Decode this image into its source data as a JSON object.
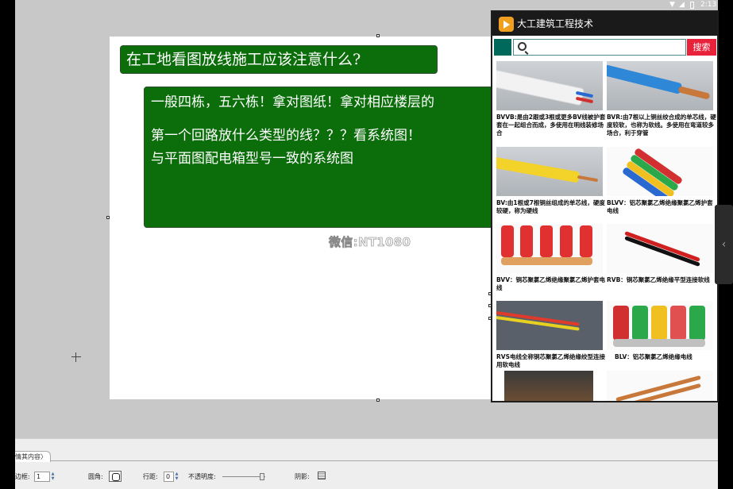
{
  "slide": {
    "title": "在工地看图放线施工应该注意什么?",
    "lines": [
      "一般四栋，五六栋！拿对图纸！拿对相应楼层的",
      "第一个回路放什么类型的线？？？看系统图！",
      "与平面图配电箱型号一致的系统图"
    ],
    "watermark": "微信:NT1080"
  },
  "toolbar": {
    "tab_label": "情其内容〉",
    "border_label": "边框:",
    "border_value": "1",
    "round_label": "圆角:",
    "spacing_label": "行距:",
    "spacing_value": "0",
    "opacity_label": "不透明度:",
    "shadow_label": "阴影:"
  },
  "status_bar": {
    "time": "2:13"
  },
  "app": {
    "title": "大工建筑工程技术",
    "search_button": "搜索",
    "search_placeholder": "",
    "items": [
      {
        "caption": "BVVB:是由2跟或3根或更多BV线被护套套在一起组合而成，多使用在明线装修场合"
      },
      {
        "caption": "BVR:由7根以上铜丝绞合成的单芯线，硬度较软，也称为软线。多使用在弯道较多场合，利于穿管"
      },
      {
        "caption": "BV:由1根或7根铜丝组成的单芯线，硬度较硬，称为硬线"
      },
      {
        "caption": "BLVV：铝芯聚氯乙烯绝缘聚氯乙烯护套电线"
      },
      {
        "caption": "BVV：铜芯聚氯乙烯绝缘聚氯乙烯护套电线"
      },
      {
        "caption": "RVB：铜芯聚氯乙烯绝缘平型连接软线"
      },
      {
        "caption": "RVS电线全称铜芯聚氯乙烯绝缘绞型连接用软电线"
      },
      {
        "caption": "BLV：铝芯聚氯乙烯绝缘电线"
      }
    ]
  }
}
